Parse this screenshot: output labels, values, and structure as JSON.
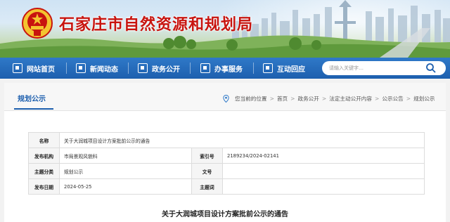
{
  "site": {
    "title": "石家庄市自然资源和规划局"
  },
  "nav": {
    "items": [
      {
        "label": "网站首页",
        "icon": "home-icon"
      },
      {
        "label": "新闻动态",
        "icon": "news-icon"
      },
      {
        "label": "政务公开",
        "icon": "open-gov-icon"
      },
      {
        "label": "办事服务",
        "icon": "service-icon"
      },
      {
        "label": "互动回应",
        "icon": "interaction-icon"
      }
    ],
    "search": {
      "placeholder": "请输入关键字…",
      "icon": "search-icon"
    }
  },
  "section": {
    "tab": "规划公示"
  },
  "breadcrumb": {
    "prefix": "您当前的位置",
    "items": [
      "首页",
      "政务公开",
      "法定主动公开内容",
      "公示公告",
      "规划公示"
    ]
  },
  "info": {
    "name_label": "名称",
    "name_value": "关于大润城项目设计方案批前公示的通告",
    "org_label": "发布机构",
    "org_value": "市局景观风貌科",
    "index_label": "索引号",
    "index_value": "2189234/2024-02141",
    "category_label": "主题分类",
    "category_value": "规划公示",
    "docno_label": "文号",
    "docno_value": "",
    "date_label": "发布日期",
    "date_value": "2024-05-25",
    "keywords_label": "主题词",
    "keywords_value": ""
  },
  "article": {
    "title": "关于大润城项目设计方案批前公示的通告"
  },
  "colors": {
    "brand_red": "#c8140f",
    "nav_blue": "#1d5fae"
  }
}
